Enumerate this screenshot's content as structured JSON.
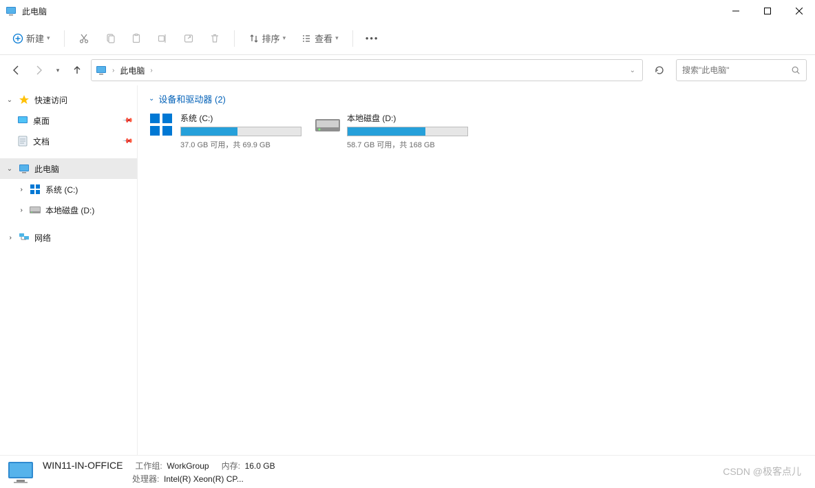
{
  "window": {
    "title": "此电脑"
  },
  "toolbar": {
    "new_label": "新建",
    "sort_label": "排序",
    "view_label": "查看"
  },
  "address": {
    "crumb": "此电脑"
  },
  "search": {
    "placeholder": "搜索\"此电脑\""
  },
  "sidebar": {
    "quick_access": "快速访问",
    "desktop": "桌面",
    "documents": "文档",
    "this_pc": "此电脑",
    "drive_c": "系统 (C:)",
    "drive_d": "本地磁盘 (D:)",
    "network": "网络"
  },
  "section": {
    "devices_header": "设备和驱动器 (2)"
  },
  "drives": {
    "c": {
      "name": "系统 (C:)",
      "status": "37.0 GB 可用，共 69.9 GB",
      "fill_percent": 47
    },
    "d": {
      "name": "本地磁盘 (D:)",
      "status": "58.7 GB 可用，共 168 GB",
      "fill_percent": 65
    }
  },
  "status": {
    "computer_name": "WIN11-IN-OFFICE",
    "workgroup_label": "工作组:",
    "workgroup_value": "WorkGroup",
    "memory_label": "内存:",
    "memory_value": "16.0 GB",
    "cpu_label": "处理器:",
    "cpu_value": "Intel(R) Xeon(R) CP..."
  },
  "watermark": "CSDN @极客点儿"
}
